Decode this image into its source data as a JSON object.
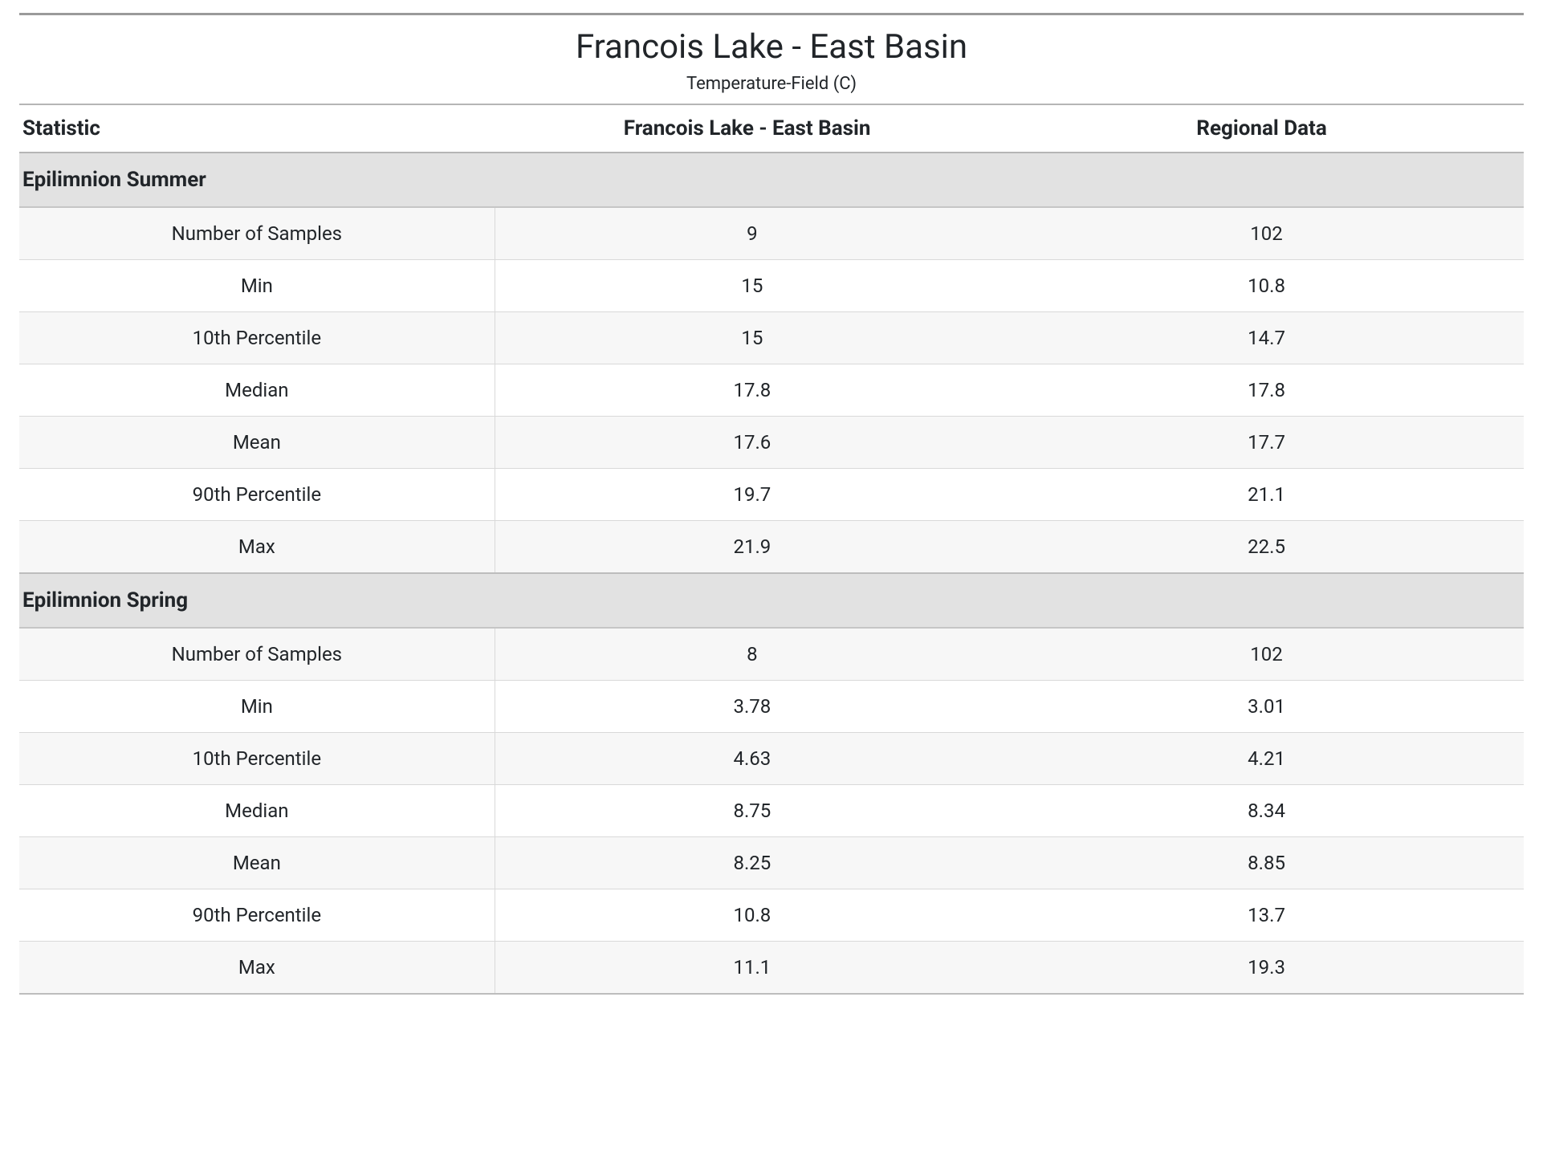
{
  "header": {
    "title": "Francois Lake - East Basin",
    "subtitle": "Temperature-Field (C)"
  },
  "columns": {
    "stat": "Statistic",
    "local": "Francois Lake - East Basin",
    "regional": "Regional Data"
  },
  "stat_labels": {
    "samples": "Number of Samples",
    "min": "Min",
    "p10": "10th Percentile",
    "median": "Median",
    "mean": "Mean",
    "p90": "90th Percentile",
    "max": "Max"
  },
  "sections": [
    {
      "title": "Epilimnion Summer",
      "rows": {
        "samples": {
          "local": "9",
          "regional": "102"
        },
        "min": {
          "local": "15",
          "regional": "10.8"
        },
        "p10": {
          "local": "15",
          "regional": "14.7"
        },
        "median": {
          "local": "17.8",
          "regional": "17.8"
        },
        "mean": {
          "local": "17.6",
          "regional": "17.7"
        },
        "p90": {
          "local": "19.7",
          "regional": "21.1"
        },
        "max": {
          "local": "21.9",
          "regional": "22.5"
        }
      }
    },
    {
      "title": "Epilimnion Spring",
      "rows": {
        "samples": {
          "local": "8",
          "regional": "102"
        },
        "min": {
          "local": "3.78",
          "regional": "3.01"
        },
        "p10": {
          "local": "4.63",
          "regional": "4.21"
        },
        "median": {
          "local": "8.75",
          "regional": "8.34"
        },
        "mean": {
          "local": "8.25",
          "regional": "8.85"
        },
        "p90": {
          "local": "10.8",
          "regional": "13.7"
        },
        "max": {
          "local": "11.1",
          "regional": "19.3"
        }
      }
    }
  ]
}
